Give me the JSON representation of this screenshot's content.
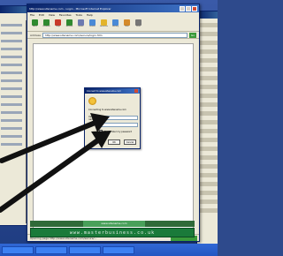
{
  "browser": {
    "title": "http://www.sitename.com - Login - Microsoft Internet Explorer",
    "menu": [
      "File",
      "Edit",
      "View",
      "Favorites",
      "Tools",
      "Help"
    ],
    "toolbar": [
      {
        "label": "Back",
        "icon": "back-arrow-icon",
        "color": "#2f8a2f"
      },
      {
        "label": "Forward",
        "icon": "forward-arrow-icon",
        "color": "#2f8a2f"
      },
      {
        "label": "Stop",
        "icon": "stop-icon",
        "color": "#c83a2a"
      },
      {
        "label": "Refresh",
        "icon": "refresh-icon",
        "color": "#2f8a2f"
      },
      {
        "label": "Home",
        "icon": "home-icon",
        "color": "#6c7ab0"
      },
      {
        "label": "Search",
        "icon": "search-icon",
        "color": "#4a8ad6"
      },
      {
        "label": "Favorites",
        "icon": "star-icon",
        "color": "#e3b42a"
      },
      {
        "label": "History",
        "icon": "history-icon",
        "color": "#4a8ad6"
      },
      {
        "label": "Mail",
        "icon": "mail-icon",
        "color": "#d48a2a"
      },
      {
        "label": "Print",
        "icon": "print-icon",
        "color": "#777777"
      }
    ],
    "address_label": "Address",
    "address_value": "http://www.sitename.com/secure/login.htm",
    "go_label": "Go",
    "status_text": "Opening page http://www.sitename.com/secure/...",
    "zone_text": "Internet"
  },
  "dialog": {
    "title": "Connect to www.sitename.com",
    "message": "Connecting to www.sitename.com",
    "username_label": "User name:",
    "password_label": "Password:",
    "remember_label": "Remember my password",
    "ok_label": "OK",
    "cancel_label": "Cancel"
  },
  "banner": {
    "text": "www.masterbusiness.co.uk",
    "top_text": "www.sitename.com"
  },
  "colors": {
    "desktop": "#294a96",
    "titlebar": "#0a246a",
    "banner": "#1a7a3a",
    "arrow": "#111111"
  }
}
